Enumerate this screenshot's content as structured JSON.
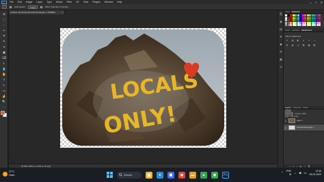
{
  "app": {
    "badge": "Ps"
  },
  "menu": {
    "items": [
      "File",
      "Edit",
      "Image",
      "Layer",
      "Type",
      "Select",
      "Filter",
      "3D",
      "View",
      "Plugins",
      "Window",
      "Help"
    ]
  },
  "window_controls": {
    "minimize": "—",
    "maximize": "□",
    "close": "✕"
  },
  "options": {
    "auto_select_label": "Auto-Select:",
    "auto_select_value": "Layer",
    "transform_label": "Show Transform Controls"
  },
  "document": {
    "tab_title": "Untitled-1 @ 33.3% (Rounded Rectangle 1, RGB/8#)",
    "close": "×",
    "status": "33.33%   1600 px x 1100 px (72 ppi)",
    "artwork_text": {
      "line1": "LOCALS",
      "line2": "ONLY!"
    }
  },
  "tools": [
    "⊕",
    "⬚",
    "◌",
    "✂",
    "⌗",
    "✎",
    "⌖",
    "▣",
    "⌫",
    "◐",
    "💧",
    "✋",
    "T",
    "↖",
    "▭",
    "☝",
    "🔍",
    "⋯"
  ],
  "panels": {
    "color_tabs": [
      "Color",
      "Swatches"
    ],
    "adjust_tabs": [
      "Learn",
      "Libraries",
      "Adjustments"
    ],
    "adjust_label": "Add an adjustment",
    "adjust_icons": [
      "☀",
      "▥",
      "◧",
      "⊿",
      "▽",
      "◑",
      "⚖",
      "▤",
      "◫",
      "⬒",
      "▦",
      "◩"
    ],
    "layers_tabs": [
      "Layers",
      "Channels",
      "Paths"
    ],
    "kind_label": "Kind",
    "blend_mode": "Normal",
    "opacity_label": "Opacity: 100%",
    "lock_label": "Lock:",
    "fill_label": "Fill: 100%",
    "layers": [
      {
        "name": "Layer 1",
        "type": "pixel",
        "active": false
      },
      {
        "name": "Rounded Rectangle 1",
        "type": "shape",
        "active": true
      }
    ],
    "footer_icons": [
      "∞",
      "fx",
      "◐",
      "▤",
      "▭",
      "🗑"
    ],
    "strip_icons": [
      "⎘",
      "◉",
      "▤",
      "⚙",
      "◆",
      "☰",
      "▦",
      "◎"
    ]
  },
  "swatch_colors": [
    "#ffffff",
    "#000000",
    "#ff0000",
    "#ffff00",
    "#00ff00",
    "#00ffff",
    "#0000ff",
    "#ff00ff",
    "#ff6600",
    "#ffcc00",
    "#99cc00",
    "#00cc99",
    "#0099ff",
    "#6633cc",
    "#cc3399",
    "#e6e6e6",
    "#333333",
    "#cc0000",
    "#cccc00",
    "#00cc00",
    "#00cccc",
    "#0000cc",
    "#cc00cc",
    "#cc5200",
    "#cca300",
    "#7aa300",
    "#00a37a",
    "#007acc",
    "#5229a3",
    "#a3297a",
    "#cccccc",
    "#4d4d4d",
    "#990000",
    "#999900",
    "#009900",
    "#009999",
    "#000099",
    "#990099",
    "#993d00",
    "#997a00",
    "#5c7a00",
    "#007a5c",
    "#005c99",
    "#3d1f7a",
    "#7a1f5c",
    "#b3b3b3",
    "#666666",
    "#ff9999",
    "#ffff99",
    "#99ff99",
    "#99ffff",
    "#9999ff",
    "#ff99ff",
    "#ffb380",
    "#ffe680",
    "#ccff80",
    "#80ffd9",
    "#80ccff",
    "#b399ff",
    "#ff99cc",
    "#999999",
    "#808080",
    "#ffcccc",
    "#ffffcc",
    "#ccffcc",
    "#ccffff",
    "#ccccff",
    "#ffccff",
    "#ffd9bf",
    "#fff2bf",
    "#e6ffbf",
    "#bfffec",
    "#bfe6ff",
    "#d9ccff",
    "#ffcce6"
  ],
  "taskbar": {
    "weather_temp": "27°C",
    "weather_desc": "Haze",
    "search_label": "Search",
    "apps": [
      {
        "name": "explorer",
        "color": "#f0b429",
        "glyph": "▆"
      },
      {
        "name": "edge",
        "color": "#1f8ed6",
        "glyph": "e"
      },
      {
        "name": "store",
        "color": "#3a6ee8",
        "glyph": "▦"
      },
      {
        "name": "chrome",
        "color": "#db4437",
        "glyph": "◉"
      },
      {
        "name": "files",
        "color": "#e6a317",
        "glyph": "▬"
      },
      {
        "name": "vpn",
        "color": "#2fa84f",
        "glyph": "▲"
      },
      {
        "name": "chrome-2",
        "color": "#34a853",
        "glyph": "◉"
      },
      {
        "name": "photoshop",
        "color": "#0a1f33",
        "glyph": "Ps"
      }
    ],
    "lang1": "ENG",
    "lang2": "IN",
    "time": "12:46",
    "date": "08-03-2023"
  }
}
